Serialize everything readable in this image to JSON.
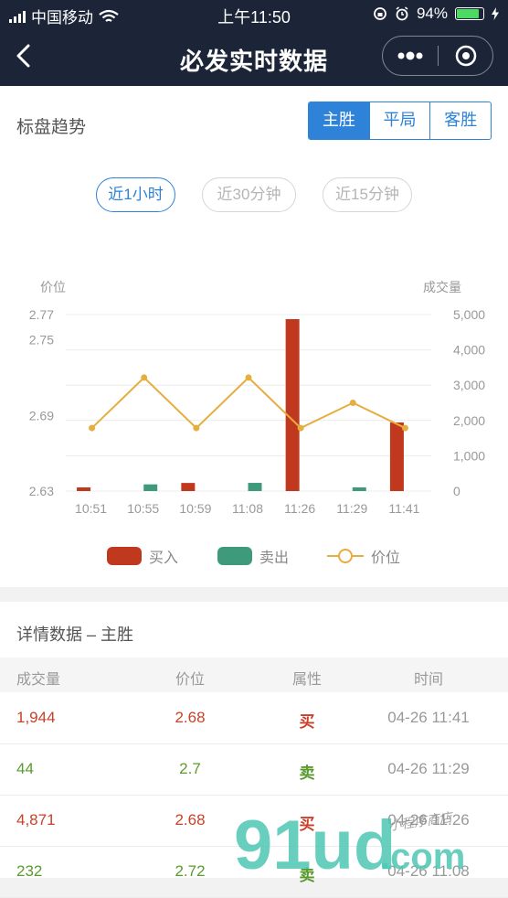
{
  "status_bar": {
    "carrier": "中国移动",
    "time": "上午11:50",
    "battery": "94%",
    "battery_level": 0.94
  },
  "nav": {
    "title": "必发实时数据"
  },
  "trend": {
    "title": "标盘趋势",
    "tabs": [
      "主胜",
      "平局",
      "客胜"
    ],
    "active_tab": "主胜",
    "ranges": [
      "近1小时",
      "近30分钟",
      "近15分钟"
    ],
    "active_range": "近1小时"
  },
  "chart_data": {
    "type": "bar+line",
    "y_left_label": "价位",
    "y_right_label": "成交量",
    "y_left_ticks": [
      "2.77",
      "2.75",
      "2.69",
      "2.63"
    ],
    "y_right_ticks": [
      "5,000",
      "4,000",
      "3,000",
      "2,000",
      "1,000",
      "0"
    ],
    "y_right_range": [
      0,
      5000
    ],
    "categories": [
      "10:51",
      "10:55",
      "10:59",
      "11:08",
      "11:26",
      "11:29",
      "11:41"
    ],
    "series": [
      {
        "name": "买入",
        "type": "bar",
        "color": "#c0391f",
        "values": [
          80,
          0,
          230,
          0,
          4871,
          0,
          1944
        ]
      },
      {
        "name": "卖出",
        "type": "bar",
        "color": "#3f9a7b",
        "values": [
          0,
          190,
          0,
          232,
          0,
          44,
          0
        ]
      },
      {
        "name": "价位",
        "type": "line",
        "color": "#e6ad3f",
        "values": [
          2.68,
          2.72,
          2.68,
          2.72,
          2.68,
          2.7,
          2.68
        ]
      }
    ],
    "price_axis_map": {
      "value_at_0": 2.63,
      "value_at_5000": 2.77
    },
    "grid": true,
    "legend_position": "bottom"
  },
  "detail": {
    "title": "详情数据 – 主胜",
    "columns": [
      "成交量",
      "价位",
      "属性",
      "时间"
    ],
    "rows": [
      {
        "volume": "1,944",
        "price": "2.68",
        "side": "买",
        "time": "04-26 11:41",
        "type": "buy"
      },
      {
        "volume": "44",
        "price": "2.7",
        "side": "卖",
        "time": "04-26 11:29",
        "type": "sell"
      },
      {
        "volume": "4,871",
        "price": "2.68",
        "side": "买",
        "time": "04-26 11:26",
        "type": "buy"
      },
      {
        "volume": "232",
        "price": "2.72",
        "side": "卖",
        "time": "04-26 11:08",
        "type": "sell"
      }
    ]
  },
  "watermark": {
    "brand": "91ud",
    "suffix": ".com",
    "tagline": "小程序商店"
  }
}
